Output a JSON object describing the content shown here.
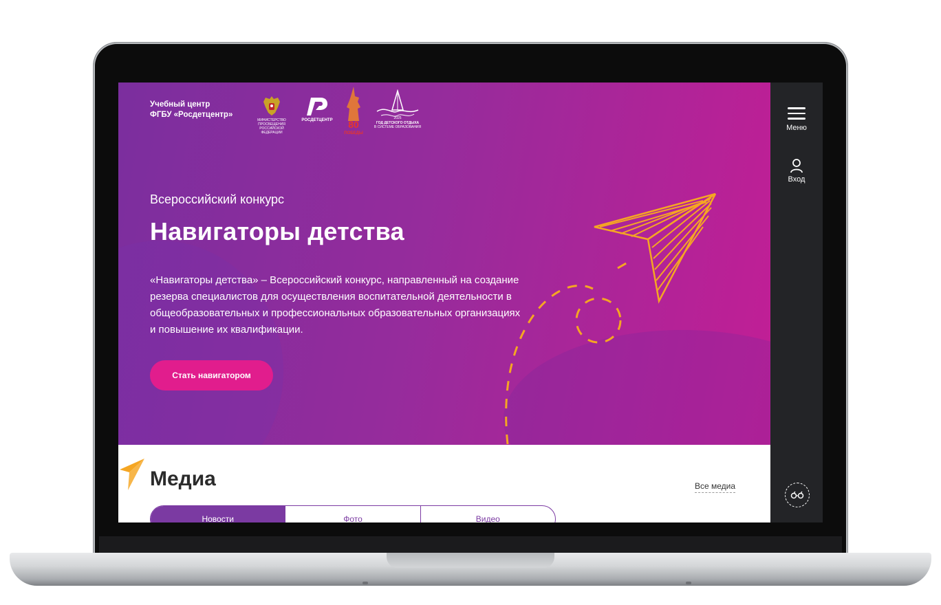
{
  "brand": {
    "line1": "Учебный центр",
    "line2": "ФГБУ «Росдетцентр»"
  },
  "logos": [
    {
      "icon": "coat-of-arms-icon",
      "caption1": "МИНИСТЕРСТВО ПРОСВЕЩЕНИЯ",
      "caption2": "РОССИЙСКОЙ ФЕДЕРАЦИИ"
    },
    {
      "icon": "rosdetcentr-logo-icon",
      "caption1": "РОСДЕТЦЕНТР"
    },
    {
      "icon": "victory-80-logo-icon",
      "caption1": "80",
      "caption2": "ПОБЕДЫ"
    },
    {
      "icon": "childrens-rest-year-logo-icon",
      "caption0": "2025",
      "caption1": "ГОД ДЕТСКОГО ОТДЫХА",
      "caption2": "В СИСТЕМЕ ОБРАЗОВАНИЯ"
    }
  ],
  "sidebar": {
    "menu_label": "Меню",
    "login_label": "Вход",
    "accessibility_icon": "glasses-icon"
  },
  "hero": {
    "overline": "Всероссийский конкурс",
    "title": "Навигаторы детства",
    "description": "«Навигаторы детства» – Всероссийский конкурс, направленный на создание резерва специалистов для осуществления воспитательной деятельности в общеобразовательных и профессиональных образовательных организациях и повышение их квалификации.",
    "cta_label": "Стать навигатором"
  },
  "media": {
    "title": "Медиа",
    "all_link": "Все медиа",
    "tabs": [
      {
        "label": "Новости",
        "active": true
      },
      {
        "label": "Фото",
        "active": false
      },
      {
        "label": "Видео",
        "active": false
      }
    ]
  },
  "colors": {
    "hero_start": "#7b2e9e",
    "hero_end": "#c21e95",
    "cta": "#e11d8d",
    "accent_orange": "#f5a623",
    "sidebar": "#232427",
    "tab_purple": "#7b3aa2"
  }
}
